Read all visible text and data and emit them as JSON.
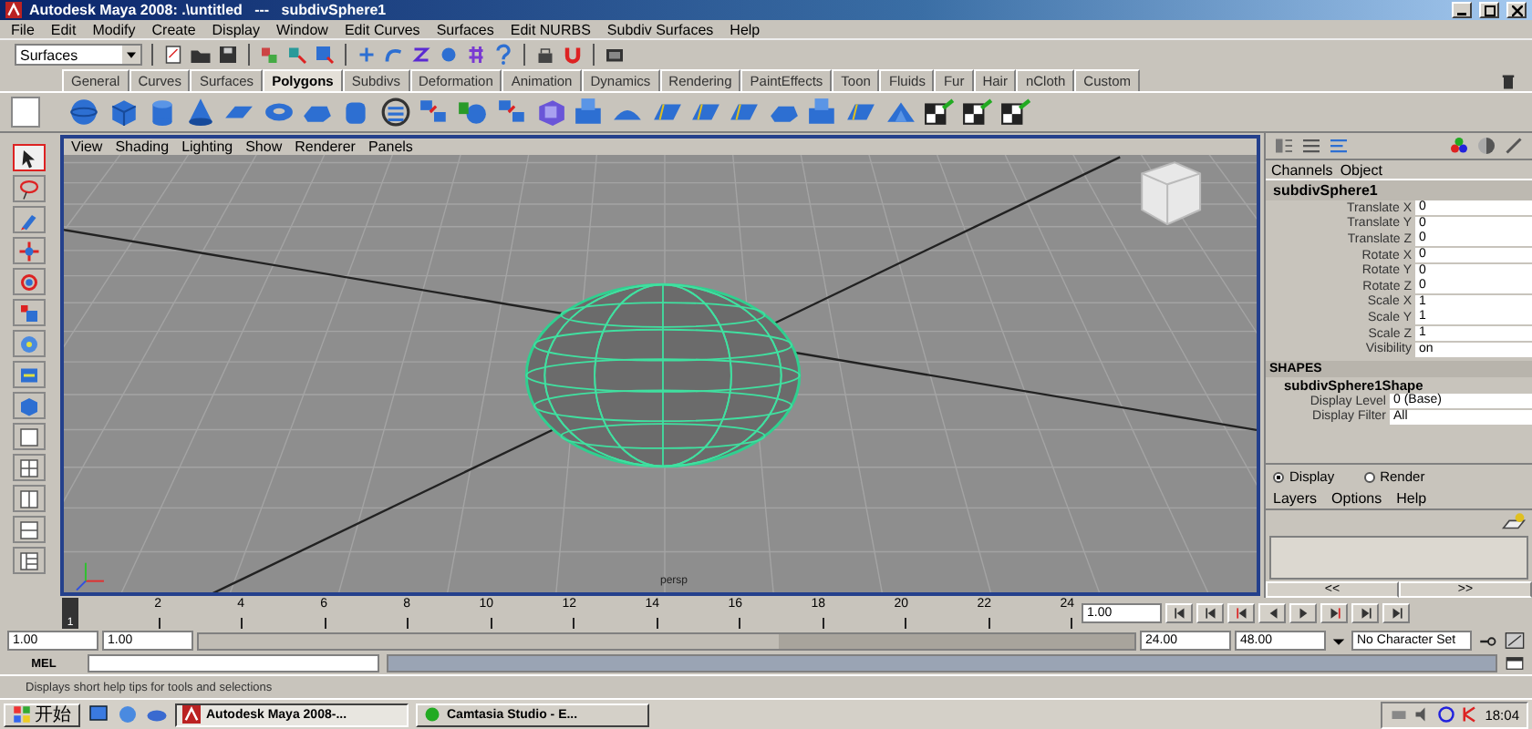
{
  "window": {
    "title": "Autodesk Maya 2008: .\\untitled   ---   subdivSphere1"
  },
  "menu_bar": [
    "File",
    "Edit",
    "Modify",
    "Create",
    "Display",
    "Window",
    "Edit Curves",
    "Surfaces",
    "Edit NURBS",
    "Subdiv Surfaces",
    "Help"
  ],
  "status_line": {
    "menu_set": "Surfaces"
  },
  "shelf": {
    "tabs": [
      {
        "label": "General",
        "selected": false
      },
      {
        "label": "Curves",
        "selected": false
      },
      {
        "label": "Surfaces",
        "selected": false
      },
      {
        "label": "Polygons",
        "selected": true
      },
      {
        "label": "Subdivs",
        "selected": false
      },
      {
        "label": "Deformation",
        "selected": false
      },
      {
        "label": "Animation",
        "selected": false
      },
      {
        "label": "Dynamics",
        "selected": false
      },
      {
        "label": "Rendering",
        "selected": false
      },
      {
        "label": "PaintEffects",
        "selected": false
      },
      {
        "label": "Toon",
        "selected": false
      },
      {
        "label": "Fluids",
        "selected": false
      },
      {
        "label": "Fur",
        "selected": false
      },
      {
        "label": "Hair",
        "selected": false
      },
      {
        "label": "nCloth",
        "selected": false
      },
      {
        "label": "Custom",
        "selected": false
      }
    ]
  },
  "viewport": {
    "menu": [
      "View",
      "Shading",
      "Lighting",
      "Show",
      "Renderer",
      "Panels"
    ],
    "camera": "persp"
  },
  "channel_box": {
    "menu": [
      "Channels",
      "Object"
    ],
    "node": "subdivSphere1",
    "attributes": [
      {
        "name": "Translate X",
        "value": "0"
      },
      {
        "name": "Translate Y",
        "value": "0"
      },
      {
        "name": "Translate Z",
        "value": "0"
      },
      {
        "name": "Rotate X",
        "value": "0"
      },
      {
        "name": "Rotate Y",
        "value": "0"
      },
      {
        "name": "Rotate Z",
        "value": "0"
      },
      {
        "name": "Scale X",
        "value": "1"
      },
      {
        "name": "Scale Y",
        "value": "1"
      },
      {
        "name": "Scale Z",
        "value": "1"
      },
      {
        "name": "Visibility",
        "value": "on"
      }
    ],
    "shapes_header": "SHAPES",
    "shape_node": "subdivSphere1Shape",
    "shape_attributes": [
      {
        "name": "Display Level",
        "value": "0 (Base)"
      },
      {
        "name": "Display Filter",
        "value": "All"
      }
    ]
  },
  "layer_editor": {
    "modes": [
      {
        "label": "Display",
        "selected": true
      },
      {
        "label": "Render",
        "selected": false
      }
    ],
    "menu": [
      "Layers",
      "Options",
      "Help"
    ],
    "nav": [
      "<<",
      ">>"
    ]
  },
  "time_slider": {
    "current_frame": "1",
    "level": 0,
    "ticks": [
      "2",
      "4",
      "6",
      "8",
      "10",
      "12",
      "14",
      "16",
      "18",
      "20",
      "22",
      "24"
    ],
    "frame_field": "1.00"
  },
  "range_slider": {
    "start": "1.00",
    "playback_start": "1.00",
    "playback_end": "24.00",
    "end": "48.00",
    "level": 0.62,
    "character_set": "No Character Set"
  },
  "command_line": {
    "label": "MEL"
  },
  "help_line": "Displays short help tips for tools and selections",
  "taskbar": {
    "start": "开始",
    "tasks": [
      {
        "label": "Autodesk Maya 2008-...",
        "selected": true
      },
      {
        "label": "Camtasia Studio - E...",
        "selected": false
      }
    ],
    "clock": "18:04"
  }
}
